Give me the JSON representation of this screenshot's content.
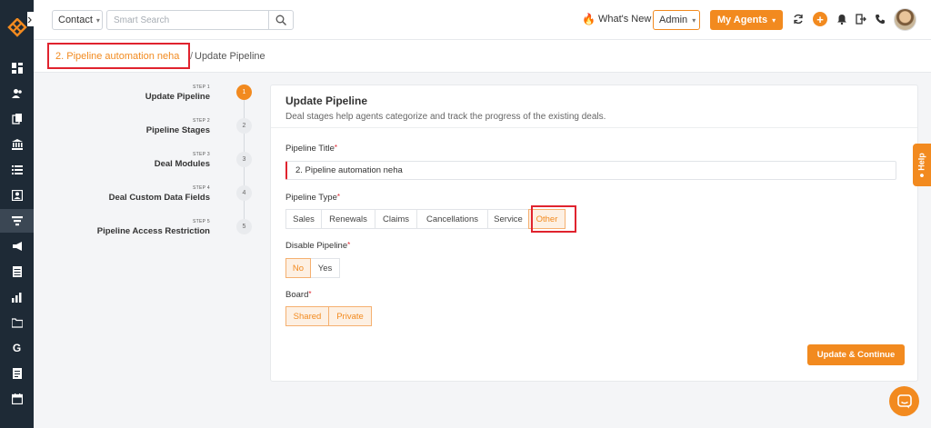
{
  "topbar": {
    "module_select": "Contact",
    "search_placeholder": "Smart Search",
    "whats_new": "What's New",
    "role_select": "Admin",
    "agents_button": "My Agents"
  },
  "breadcrumb": {
    "parent": "2. Pipeline automation neha",
    "separator": "/",
    "current": "Update Pipeline"
  },
  "steps": [
    {
      "num_label": "STEP 1",
      "title": "Update Pipeline",
      "index": "1",
      "active": true
    },
    {
      "num_label": "STEP 2",
      "title": "Pipeline Stages",
      "index": "2",
      "active": false
    },
    {
      "num_label": "STEP 3",
      "title": "Deal Modules",
      "index": "3",
      "active": false
    },
    {
      "num_label": "STEP 4",
      "title": "Deal Custom Data Fields",
      "index": "4",
      "active": false
    },
    {
      "num_label": "STEP 5",
      "title": "Pipeline Access Restriction",
      "index": "5",
      "active": false
    }
  ],
  "form": {
    "title": "Update Pipeline",
    "subtitle": "Deal stages help agents categorize and track the progress of the existing deals.",
    "pipeline_title_label": "Pipeline Title",
    "pipeline_title_value": "2. Pipeline automation neha",
    "pipeline_type_label": "Pipeline Type",
    "pipeline_types": [
      "Sales",
      "Renewals",
      "Claims",
      "Cancellations",
      "Service",
      "Other"
    ],
    "pipeline_type_selected": "Other",
    "disable_pipeline_label": "Disable Pipeline",
    "disable_options": [
      "No",
      "Yes"
    ],
    "disable_selected": "No",
    "board_label": "Board",
    "board_options": [
      "Shared",
      "Private"
    ],
    "board_selected": [
      "Shared",
      "Private"
    ],
    "submit_button": "Update & Continue",
    "required_mark": "*"
  },
  "help_tab": "Help",
  "colors": {
    "accent": "#f28a1f",
    "sidebar": "#1e2a36",
    "highlight_red": "#e0232e"
  },
  "sidebar_icons": [
    "dashboard-icon",
    "contacts-icon",
    "documents-icon",
    "bank-icon",
    "list-icon",
    "contact-card-icon",
    "pipeline-icon",
    "megaphone-icon",
    "table-icon",
    "reports-icon",
    "folder-icon",
    "google-icon",
    "notes-icon",
    "calendar-icon"
  ]
}
